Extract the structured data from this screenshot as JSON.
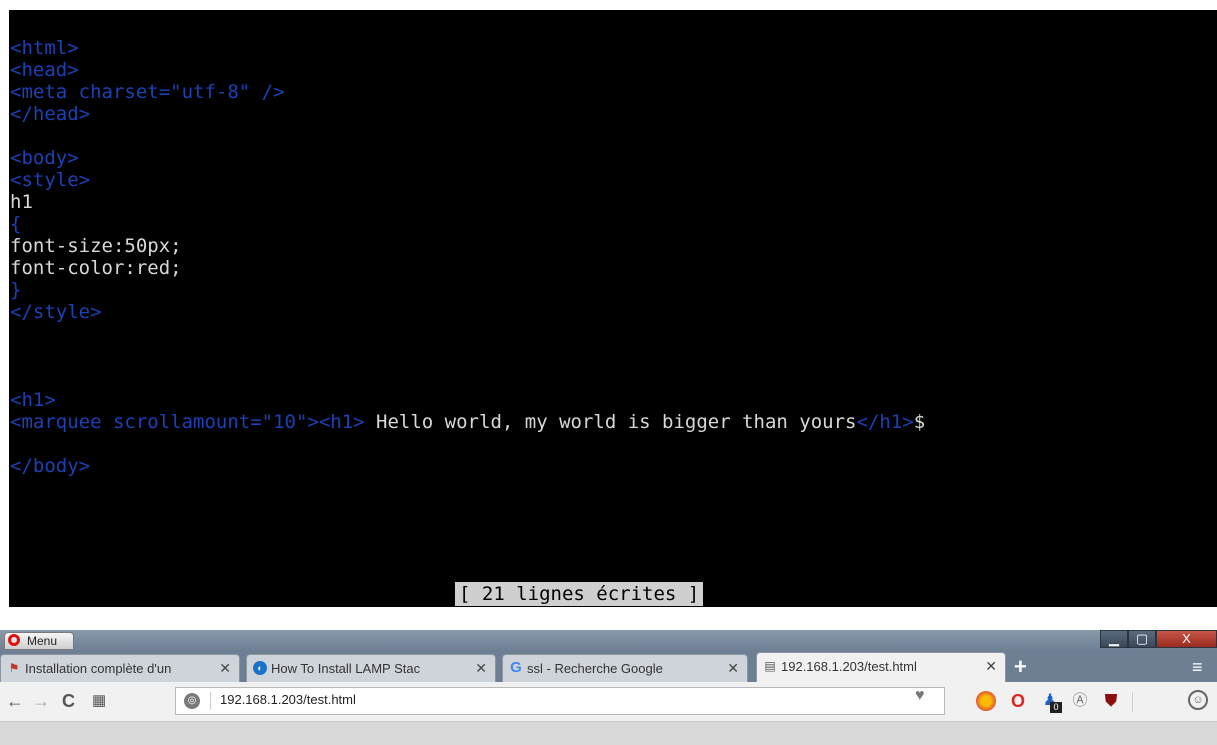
{
  "terminal": {
    "lines": [
      {
        "tag1": "<html>"
      },
      {
        "tag1": "<head>"
      },
      {
        "tag1": "<meta charset=\"utf-8\" />"
      },
      {
        "tag1": "</head>"
      },
      {
        "tag1": ""
      },
      {
        "tag1": "<body>"
      },
      {
        "tag1": "<style>"
      },
      {
        "text1": "h1"
      },
      {
        "tag1": "{"
      },
      {
        "text1": "font-size:50px;"
      },
      {
        "text1": "font-color:red;"
      },
      {
        "tag1": "}"
      },
      {
        "tag1": "</style>"
      },
      {
        "tag1": ""
      },
      {
        "tag1": ""
      },
      {
        "tag1": ""
      },
      {
        "tag1": "<h1>"
      },
      {
        "tag1": "<marquee scrollamount=\"10\"><h1>",
        "text1": " Hello world, my world is bigger than yours",
        "tag2": "</h1>",
        "text2": "$"
      },
      {
        "tag1": ""
      },
      {
        "tag1": "</body>"
      }
    ],
    "status": "[ 21 lignes écrites ]"
  },
  "browser": {
    "menu_label": "Menu",
    "window_buttons": {
      "minimize": "▁",
      "maximize": "▢",
      "close": "X"
    },
    "tabs": [
      {
        "title": "Installation complète d'un",
        "icon": "lamp-icon"
      },
      {
        "title": "How To Install LAMP Stack",
        "icon": "digitalocean-icon"
      },
      {
        "title": "ssl - Recherche Google",
        "icon": "google-icon"
      },
      {
        "title": "192.168.1.203/test.html",
        "icon": "page-icon",
        "active": true
      }
    ],
    "tab_close_glyph": "✕",
    "new_tab_glyph": "+",
    "url": "192.168.1.203/test.html",
    "extensions": [
      "duckduckgo-icon",
      "opera-icon",
      "ghostery-icon",
      "anarchy-icon",
      "ublock-icon"
    ],
    "ghostery_badge": "0"
  }
}
